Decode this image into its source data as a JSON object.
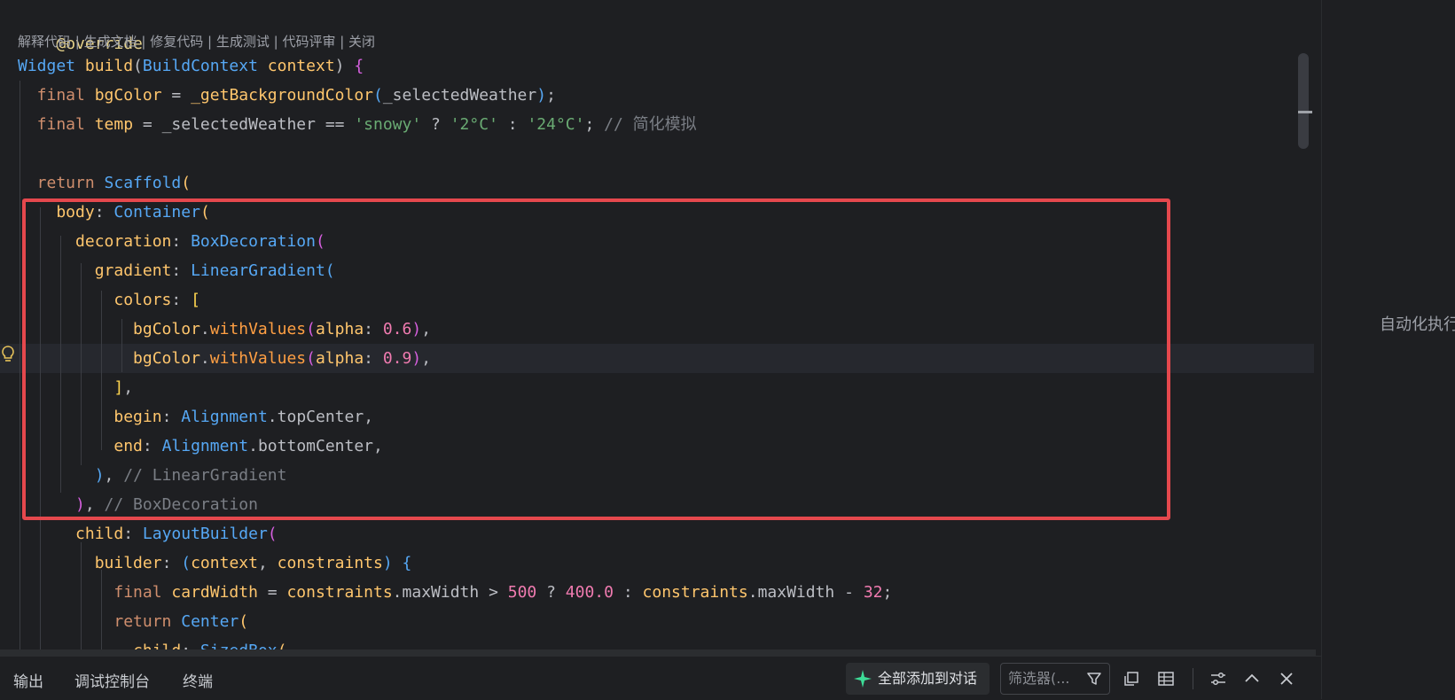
{
  "editor": {
    "annotation": "@override",
    "code_lens": [
      "解释代码",
      "生成文档",
      "修复代码",
      "生成测试",
      "代码评审",
      "关闭"
    ],
    "code_lens_separator": " | ",
    "lines": [
      [
        [
          "Widget ",
          "#56a8f5"
        ],
        [
          "build",
          "#ffc66d"
        ],
        [
          "(",
          "#bcbec4"
        ],
        [
          "BuildContext ",
          "#56a8f5"
        ],
        [
          "context",
          "#ffc66d"
        ],
        [
          ") ",
          "#bcbec4"
        ],
        [
          "{",
          "#d55fde"
        ]
      ],
      [
        [
          "  final ",
          "#cf8e6d"
        ],
        [
          "bgColor ",
          "#ffc66d"
        ],
        [
          "= ",
          "#bcbec4"
        ],
        [
          "_getBackgroundColor",
          "#ffc66d"
        ],
        [
          "(",
          "#56a8f5"
        ],
        [
          "_selectedWeather",
          "#bcbec4"
        ],
        [
          ")",
          "#56a8f5"
        ],
        [
          ";",
          "#bcbec4"
        ]
      ],
      [
        [
          "  final ",
          "#cf8e6d"
        ],
        [
          "temp ",
          "#ffc66d"
        ],
        [
          "= ",
          "#bcbec4"
        ],
        [
          "_selectedWeather ",
          "#bcbec4"
        ],
        [
          "== ",
          "#bcbec4"
        ],
        [
          "'snowy' ",
          "#6aab73"
        ],
        [
          "? ",
          "#bcbec4"
        ],
        [
          "'2°C' ",
          "#6aab73"
        ],
        [
          ": ",
          "#bcbec4"
        ],
        [
          "'24°C'",
          "#6aab73"
        ],
        [
          "; ",
          "#bcbec4"
        ],
        [
          "// 简化模拟",
          "#7a7e85"
        ]
      ],
      [],
      [
        [
          "  return ",
          "#cf8e6d"
        ],
        [
          "Scaffold",
          "#56a8f5"
        ],
        [
          "(",
          "#ffc66d"
        ]
      ],
      [
        [
          "    body",
          "#ffc66d"
        ],
        [
          ": ",
          "#bcbec4"
        ],
        [
          "Container",
          "#56a8f5"
        ],
        [
          "(",
          "#ffc66d"
        ]
      ],
      [
        [
          "      decoration",
          "#ffc66d"
        ],
        [
          ": ",
          "#bcbec4"
        ],
        [
          "BoxDecoration",
          "#56a8f5"
        ],
        [
          "(",
          "#d55fde"
        ]
      ],
      [
        [
          "        gradient",
          "#ffc66d"
        ],
        [
          ": ",
          "#bcbec4"
        ],
        [
          "LinearGradient",
          "#56a8f5"
        ],
        [
          "(",
          "#56a8f5"
        ]
      ],
      [
        [
          "          colors",
          "#ffc66d"
        ],
        [
          ": ",
          "#bcbec4"
        ],
        [
          "[",
          "#ffd54f"
        ]
      ],
      [
        [
          "            bgColor",
          "#ffc66d"
        ],
        [
          ".",
          "#bcbec4"
        ],
        [
          "withValues",
          "#ff9f43"
        ],
        [
          "(",
          "#d55fde"
        ],
        [
          "alpha",
          "#ffc66d"
        ],
        [
          ": ",
          "#bcbec4"
        ],
        [
          "0.6",
          "#f07bb0"
        ],
        [
          ")",
          "#d55fde"
        ],
        [
          ",",
          "#bcbec4"
        ]
      ],
      [
        [
          "            bgColor",
          "#ffc66d"
        ],
        [
          ".",
          "#bcbec4"
        ],
        [
          "withValues",
          "#ff9f43"
        ],
        [
          "(",
          "#d55fde"
        ],
        [
          "alpha",
          "#ffc66d"
        ],
        [
          ": ",
          "#bcbec4"
        ],
        [
          "0.9",
          "#f07bb0"
        ],
        [
          ")",
          "#d55fde"
        ],
        [
          ",",
          "#bcbec4"
        ]
      ],
      [
        [
          "          ]",
          "#ffd54f"
        ],
        [
          ",",
          "#bcbec4"
        ]
      ],
      [
        [
          "          begin",
          "#ffc66d"
        ],
        [
          ": ",
          "#bcbec4"
        ],
        [
          "Alignment",
          "#56a8f5"
        ],
        [
          ".",
          "#bcbec4"
        ],
        [
          "topCenter",
          "#bcbec4"
        ],
        [
          ",",
          "#bcbec4"
        ]
      ],
      [
        [
          "          end",
          "#ffc66d"
        ],
        [
          ": ",
          "#bcbec4"
        ],
        [
          "Alignment",
          "#56a8f5"
        ],
        [
          ".",
          "#bcbec4"
        ],
        [
          "bottomCenter",
          "#bcbec4"
        ],
        [
          ",",
          "#bcbec4"
        ]
      ],
      [
        [
          "        )",
          "#56a8f5"
        ],
        [
          ", ",
          "#bcbec4"
        ],
        [
          "// LinearGradient",
          "#7a7e85"
        ]
      ],
      [
        [
          "      )",
          "#d55fde"
        ],
        [
          ", ",
          "#bcbec4"
        ],
        [
          "// BoxDecoration",
          "#7a7e85"
        ]
      ],
      [
        [
          "      child",
          "#ffc66d"
        ],
        [
          ": ",
          "#bcbec4"
        ],
        [
          "LayoutBuilder",
          "#56a8f5"
        ],
        [
          "(",
          "#d55fde"
        ]
      ],
      [
        [
          "        builder",
          "#ffc66d"
        ],
        [
          ": ",
          "#bcbec4"
        ],
        [
          "(",
          "#56a8f5"
        ],
        [
          "context",
          "#ffc66d"
        ],
        [
          ", ",
          "#bcbec4"
        ],
        [
          "constraints",
          "#ffc66d"
        ],
        [
          ") ",
          "#56a8f5"
        ],
        [
          "{",
          "#56a8f5"
        ]
      ],
      [
        [
          "          final ",
          "#cf8e6d"
        ],
        [
          "cardWidth ",
          "#ffc66d"
        ],
        [
          "= ",
          "#bcbec4"
        ],
        [
          "constraints",
          "#ffc66d"
        ],
        [
          ".",
          "#bcbec4"
        ],
        [
          "maxWidth ",
          "#bcbec4"
        ],
        [
          "> ",
          "#bcbec4"
        ],
        [
          "500 ",
          "#f07bb0"
        ],
        [
          "? ",
          "#bcbec4"
        ],
        [
          "400.0 ",
          "#f07bb0"
        ],
        [
          ": ",
          "#bcbec4"
        ],
        [
          "constraints",
          "#ffc66d"
        ],
        [
          ".",
          "#bcbec4"
        ],
        [
          "maxWidth ",
          "#bcbec4"
        ],
        [
          "- ",
          "#bcbec4"
        ],
        [
          "32",
          "#f07bb0"
        ],
        [
          ";",
          "#bcbec4"
        ]
      ],
      [
        [
          "          return ",
          "#cf8e6d"
        ],
        [
          "Center",
          "#56a8f5"
        ],
        [
          "(",
          "#ffc66d"
        ]
      ],
      [
        [
          "            child",
          "#ffc66d"
        ],
        [
          ": ",
          "#bcbec4"
        ],
        [
          "SizedBox",
          "#56a8f5"
        ],
        [
          "(",
          "#ffc66d"
        ]
      ]
    ]
  },
  "right_panel": {
    "label": "自动化执行"
  },
  "bottom_bar": {
    "tabs": [
      "输出",
      "调试控制台",
      "终端"
    ],
    "add_all_label": "全部添加到对话",
    "filter_placeholder": "筛选器(..."
  },
  "colors": {
    "background": "#1e1f22",
    "highlight_box": "#e5484d",
    "current_line": "#26282e"
  }
}
